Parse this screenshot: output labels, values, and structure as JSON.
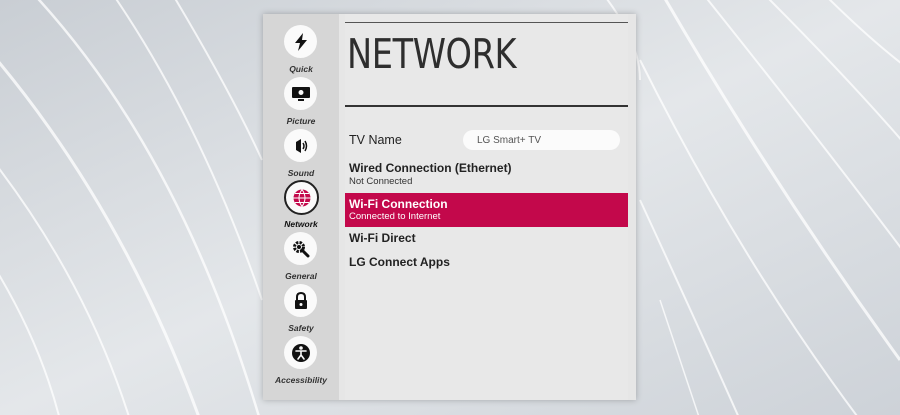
{
  "colors": {
    "accent": "#c3084b",
    "panel": "#e8e8e8",
    "sidebar": "#d6d6d6"
  },
  "sidebar": {
    "items": [
      {
        "label": "Quick",
        "icon": "lightning-icon",
        "active": false
      },
      {
        "label": "Picture",
        "icon": "picture-icon",
        "active": false
      },
      {
        "label": "Sound",
        "icon": "sound-icon",
        "active": false
      },
      {
        "label": "Network",
        "icon": "globe-icon",
        "active": true
      },
      {
        "label": "General",
        "icon": "gear-wrench-icon",
        "active": false
      },
      {
        "label": "Safety",
        "icon": "lock-icon",
        "active": false
      },
      {
        "label": "Accessibility",
        "icon": "accessibility-icon",
        "active": false
      }
    ]
  },
  "page": {
    "title": "NETWORK"
  },
  "tv_name": {
    "label": "TV Name",
    "value": "LG Smart+ TV"
  },
  "menu": {
    "wired": {
      "title": "Wired Connection (Ethernet)",
      "subtitle": "Not Connected"
    },
    "wifi": {
      "title": "Wi-Fi Connection",
      "subtitle": "Connected to Internet"
    },
    "wifi_direct": {
      "title": "Wi-Fi Direct"
    },
    "lg_connect": {
      "title": "LG Connect Apps"
    }
  }
}
